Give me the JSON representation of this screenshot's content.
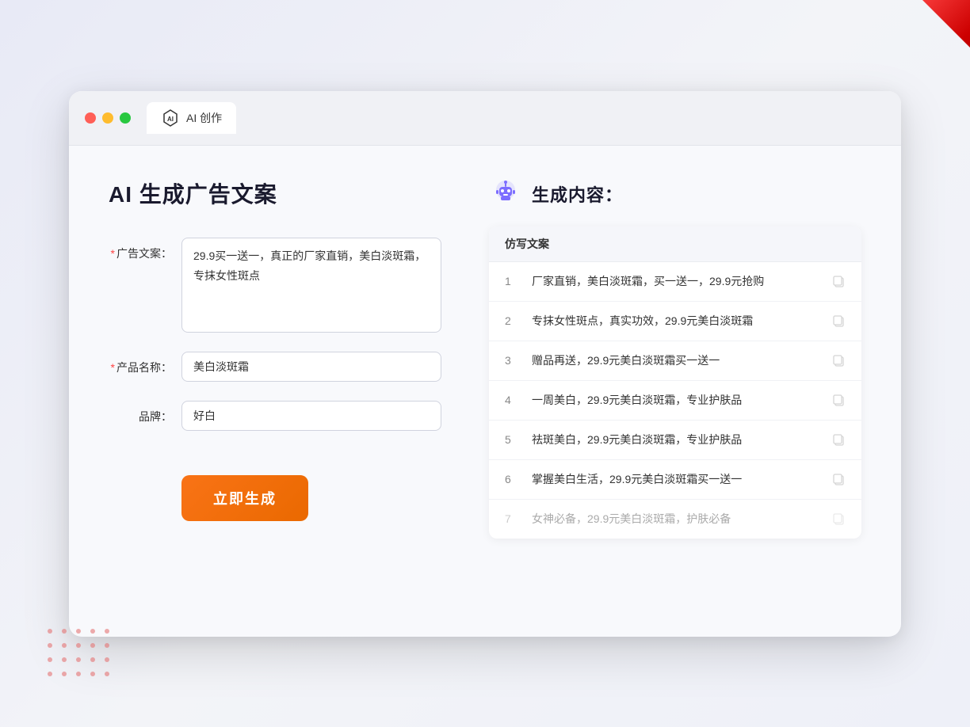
{
  "window": {
    "tab_label": "AI 创作"
  },
  "page": {
    "title": "AI 生成广告文案"
  },
  "form": {
    "ad_copy_label": "广告文案：",
    "ad_copy_required": "*",
    "ad_copy_value": "29.9买一送一，真正的厂家直销，美白淡斑霜，专抹女性斑点",
    "product_name_label": "产品名称：",
    "product_name_required": "*",
    "product_name_value": "美白淡斑霜",
    "brand_label": "品牌：",
    "brand_value": "好白",
    "submit_label": "立即生成"
  },
  "result": {
    "header_label": "生成内容：",
    "column_label": "仿写文案",
    "rows": [
      {
        "num": "1",
        "text": "厂家直销，美白淡斑霜，买一送一，29.9元抢购",
        "muted": false
      },
      {
        "num": "2",
        "text": "专抹女性斑点，真实功效，29.9元美白淡斑霜",
        "muted": false
      },
      {
        "num": "3",
        "text": "赠品再送，29.9元美白淡斑霜买一送一",
        "muted": false
      },
      {
        "num": "4",
        "text": "一周美白，29.9元美白淡斑霜，专业护肤品",
        "muted": false
      },
      {
        "num": "5",
        "text": "祛斑美白，29.9元美白淡斑霜，专业护肤品",
        "muted": false
      },
      {
        "num": "6",
        "text": "掌握美白生活，29.9元美白淡斑霜买一送一",
        "muted": false
      },
      {
        "num": "7",
        "text": "女神必备，29.9元美白淡斑霜，护肤必备",
        "muted": true
      }
    ]
  },
  "colors": {
    "accent": "#f97316",
    "primary": "#6c63ff",
    "danger": "#ff4444"
  }
}
